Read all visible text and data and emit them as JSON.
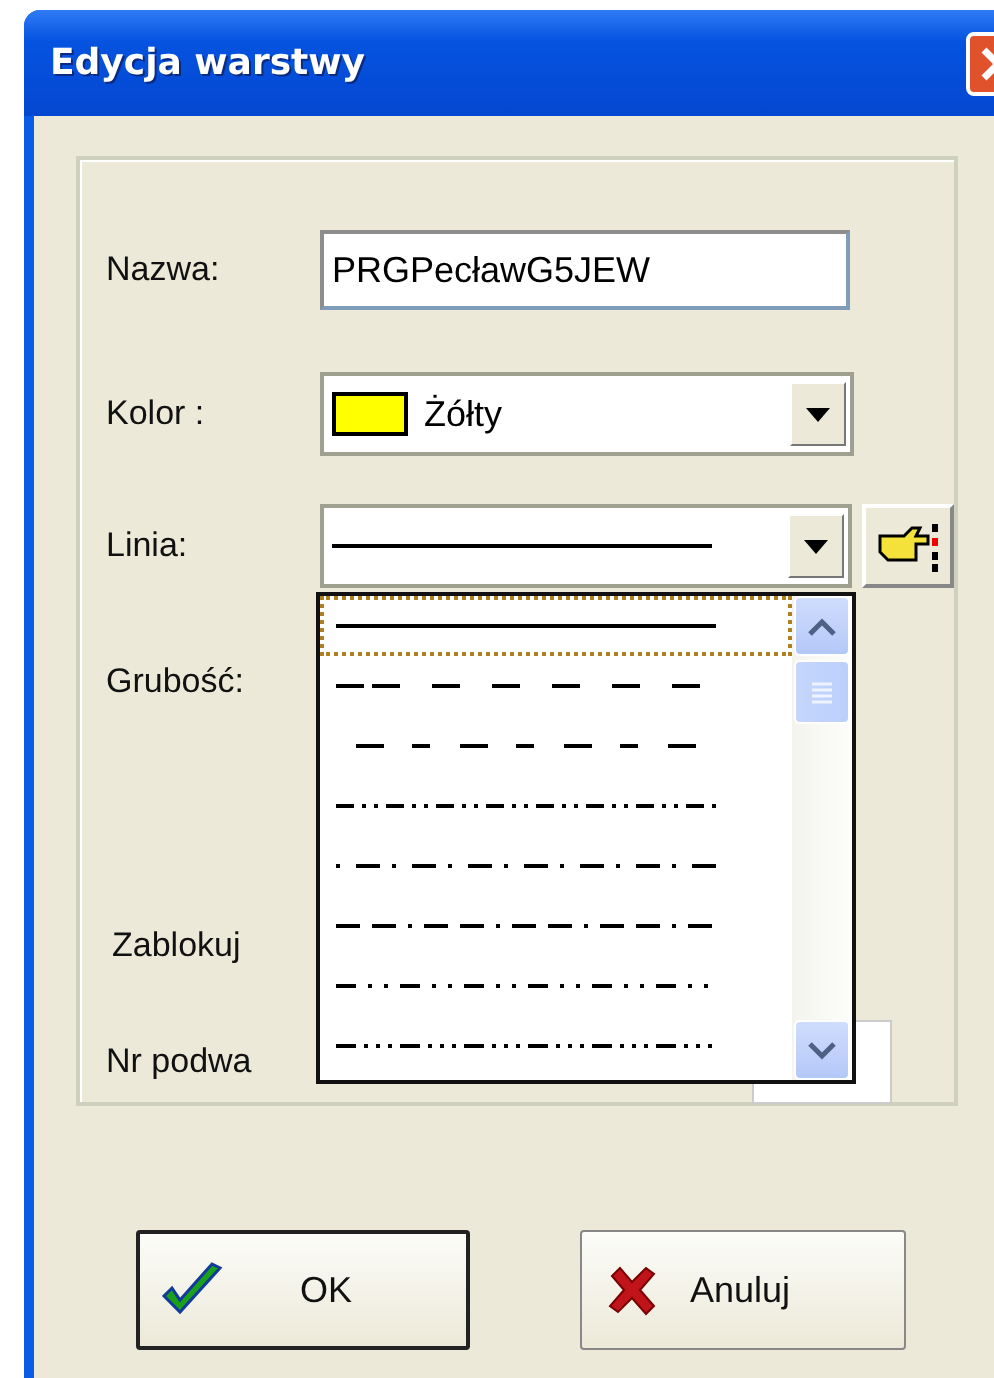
{
  "window": {
    "title": "Edycja warstwy"
  },
  "form": {
    "name_label": "Nazwa:",
    "name_value": "PRGPecławG5JEW",
    "color_label": "Kolor :",
    "color": {
      "color": "#ffff00",
      "text": "Żółty"
    },
    "line_label": "Linia:",
    "line": {
      "kind": "solid"
    },
    "thickness_label": "Grubość:",
    "lock_label": "Zablokuj",
    "subnumber_label": "Nr podwa"
  },
  "line_options": [
    {
      "kind": "solid",
      "selected": true
    },
    {
      "kind": "dash",
      "selected": false
    },
    {
      "kind": "shortdash",
      "selected": false
    },
    {
      "kind": "dashdotdot",
      "selected": false
    },
    {
      "kind": "longdash",
      "selected": false
    },
    {
      "kind": "dashdashdot",
      "selected": false
    },
    {
      "kind": "dashdot",
      "selected": false
    },
    {
      "kind": "dashdotdotdot",
      "selected": false
    }
  ],
  "buttons": [
    {
      "kind": "ok",
      "label": "OK",
      "default": true
    },
    {
      "kind": "cancel",
      "label": "Anuluj",
      "default": false
    }
  ]
}
